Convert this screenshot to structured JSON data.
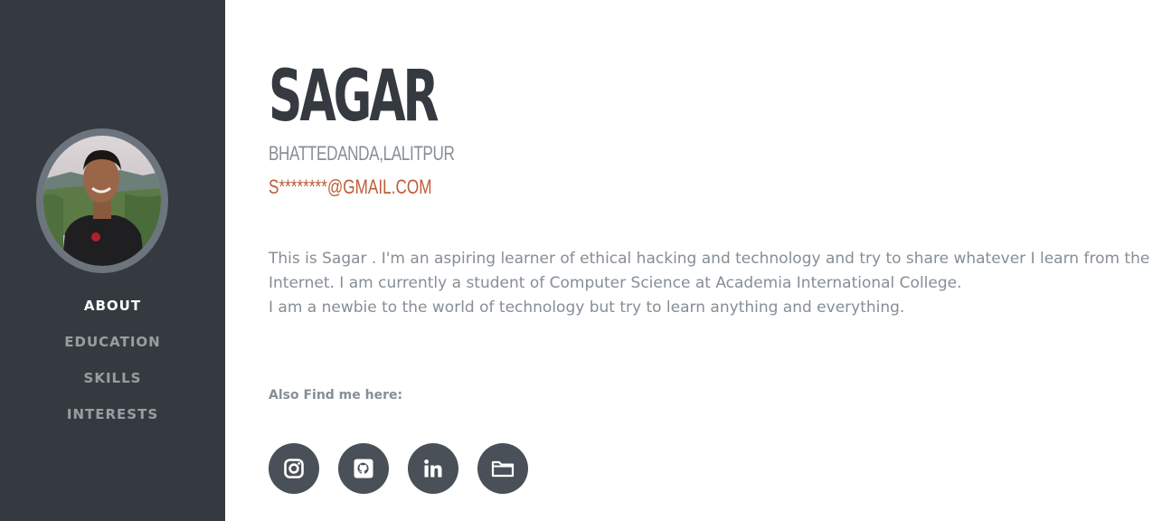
{
  "profile": {
    "name": "SAGAR",
    "location": "BHATTEDANDA,LALITPUR",
    "email": "S********@GMAIL.COM"
  },
  "nav": {
    "items": [
      {
        "label": "ABOUT",
        "active": true
      },
      {
        "label": "EDUCATION",
        "active": false
      },
      {
        "label": "SKILLS",
        "active": false
      },
      {
        "label": "INTERESTS",
        "active": false
      }
    ]
  },
  "bio": {
    "paragraph1": "This is Sagar . I'm an aspiring learner of ethical hacking and technology and try to share whatever I learn from the Internet. I am currently a student of Computer Science at Academia International College.",
    "paragraph2": "I am a newbie to the world of technology but try to learn anything and everything."
  },
  "social": {
    "title": "Also Find me here:",
    "icons": [
      "instagram-icon",
      "github-icon",
      "linkedin-icon",
      "folder-icon"
    ]
  },
  "colors": {
    "sidebar": "#343a40",
    "accent": "#bd5d38",
    "muted": "#868e96",
    "social_bg": "#495057"
  }
}
